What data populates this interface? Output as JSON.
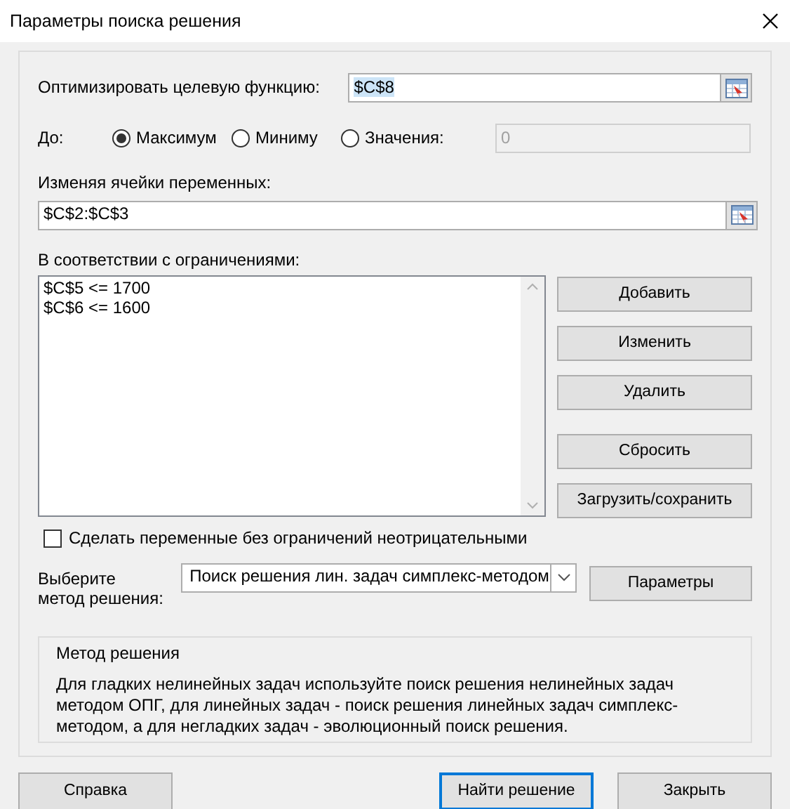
{
  "window": {
    "title": "Параметры поиска решения"
  },
  "objective": {
    "label": "Оптимизировать целевую функцию:",
    "value": "$C$8",
    "selected": true
  },
  "to": {
    "label": "До:",
    "options": [
      {
        "label": "Максимум",
        "selected": true
      },
      {
        "label": "Миниму",
        "selected": false
      },
      {
        "label": "Значения:",
        "selected": false
      }
    ],
    "value_field": {
      "value": "0",
      "disabled": true
    }
  },
  "changing": {
    "label": "Изменяя ячейки переменных:",
    "value": "$C$2:$C$3"
  },
  "constraints": {
    "label": "В соответствии с ограничениями:",
    "items": [
      "$C$5 <= 1700",
      "$C$6 <= 1600"
    ]
  },
  "side_buttons": [
    "Добавить",
    "Изменить",
    "Удалить"
  ],
  "side_buttons_lower": [
    "Сбросить",
    "Загрузить/сохранить"
  ],
  "nonnegative": {
    "label": "Сделать переменные без ограничений неотрицательными",
    "checked": false
  },
  "method": {
    "label": "Выберите\nметод решения:",
    "value": "Поиск решения лин. задач симплекс-методом",
    "button": "Параметры"
  },
  "description": {
    "title": "Метод решения",
    "text": "Для гладких нелинейных задач используйте поиск решения нелинейных задач методом ОПГ, для линейных задач - поиск решения линейных задач симплекс-методом, а для негладких задач - эволюционный поиск решения."
  },
  "footer_buttons": [
    {
      "label": "Справка",
      "default": false
    },
    {
      "label": "Найти решение",
      "default": true
    },
    {
      "label": "Закрыть",
      "default": false
    }
  ]
}
